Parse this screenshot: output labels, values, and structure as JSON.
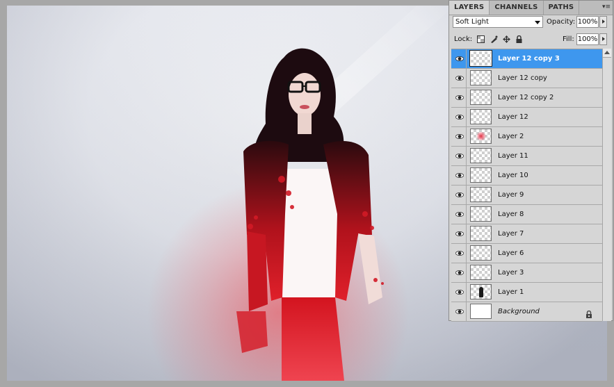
{
  "panel": {
    "tabs": [
      {
        "label": "LAYERS",
        "active": true
      },
      {
        "label": "CHANNELS",
        "active": false
      },
      {
        "label": "PATHS",
        "active": false
      }
    ],
    "menu_glyph": "▾≡",
    "blend_mode": "Soft Light",
    "opacity_label": "Opacity:",
    "opacity_value": "100%",
    "lock_label": "Lock:",
    "fill_label": "Fill:",
    "fill_value": "100%"
  },
  "layers": [
    {
      "name": "Layer 12 copy 3",
      "selected": true,
      "thumb": "transparent"
    },
    {
      "name": "Layer 12 copy",
      "selected": false,
      "thumb": "transparent"
    },
    {
      "name": "Layer 12 copy 2",
      "selected": false,
      "thumb": "transparent"
    },
    {
      "name": "Layer 12",
      "selected": false,
      "thumb": "transparent"
    },
    {
      "name": "Layer 2",
      "selected": false,
      "thumb": "red"
    },
    {
      "name": "Layer 11",
      "selected": false,
      "thumb": "transparent"
    },
    {
      "name": "Layer 10",
      "selected": false,
      "thumb": "transparent"
    },
    {
      "name": "Layer 9",
      "selected": false,
      "thumb": "transparent"
    },
    {
      "name": "Layer 8",
      "selected": false,
      "thumb": "transparent"
    },
    {
      "name": "Layer 7",
      "selected": false,
      "thumb": "transparent"
    },
    {
      "name": "Layer 6",
      "selected": false,
      "thumb": "transparent"
    },
    {
      "name": "Layer 3",
      "selected": false,
      "thumb": "transparent"
    },
    {
      "name": "Layer 1",
      "selected": false,
      "thumb": "person"
    },
    {
      "name": "Background",
      "selected": false,
      "thumb": "white",
      "italic": true,
      "locked": true
    }
  ],
  "colors": {
    "selection": "#3e97ee",
    "accent_red": "#e8202e"
  }
}
